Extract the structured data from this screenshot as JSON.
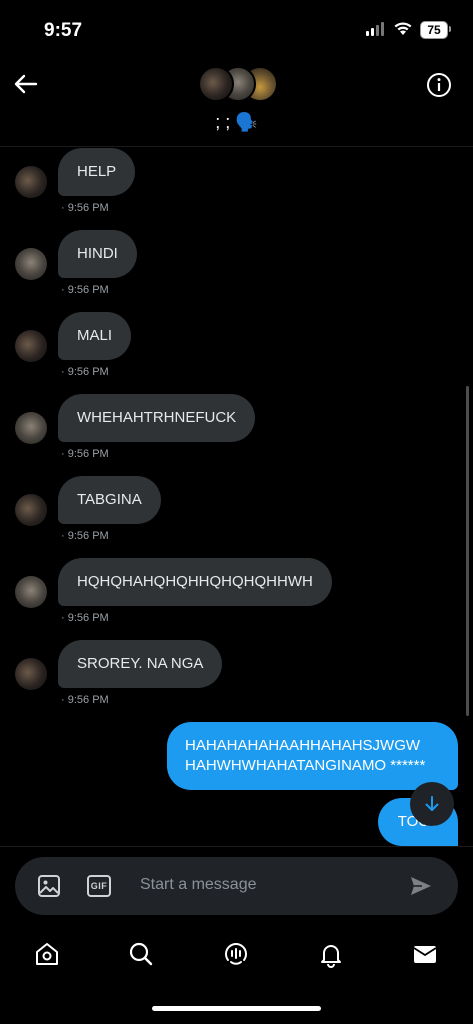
{
  "status_bar": {
    "time": "9:57",
    "battery": "75"
  },
  "header": {
    "group_name": "; ; 🗣️"
  },
  "messages": [
    {
      "text": "HELP",
      "time": "9:56 PM",
      "avatar": "a"
    },
    {
      "text": "HINDI",
      "time": "9:56 PM",
      "avatar": "b"
    },
    {
      "text": "MALI",
      "time": "9:56 PM",
      "avatar": "a"
    },
    {
      "text": "WHEHAHTRHNEFUCK",
      "time": "9:56 PM",
      "avatar": "b"
    },
    {
      "text": "TABGINA",
      "time": "9:56 PM",
      "avatar": "a"
    },
    {
      "text": "HQHQHAHQHQHHQHQHQHHWH",
      "time": "9:56 PM",
      "avatar": "b"
    },
    {
      "text": "SROREY. NA NGA",
      "time": "9:56 PM",
      "avatar": "a"
    }
  ],
  "outgoing": [
    {
      "line1": "HAHAHAHAHAAHHAHAHSJWGW",
      "line2": "HAHWHWHAHATANGINAMO ******"
    },
    {
      "text": "TOUT"
    }
  ],
  "composer": {
    "placeholder": "Start a message",
    "gif_label": "GIF"
  },
  "nav": [
    "home-icon",
    "search-icon",
    "spaces-icon",
    "notifications-icon",
    "messages-icon"
  ],
  "colors": {
    "accent": "#1d9bf0",
    "bubble_in": "#2f3336",
    "composer_bg": "#202327"
  }
}
